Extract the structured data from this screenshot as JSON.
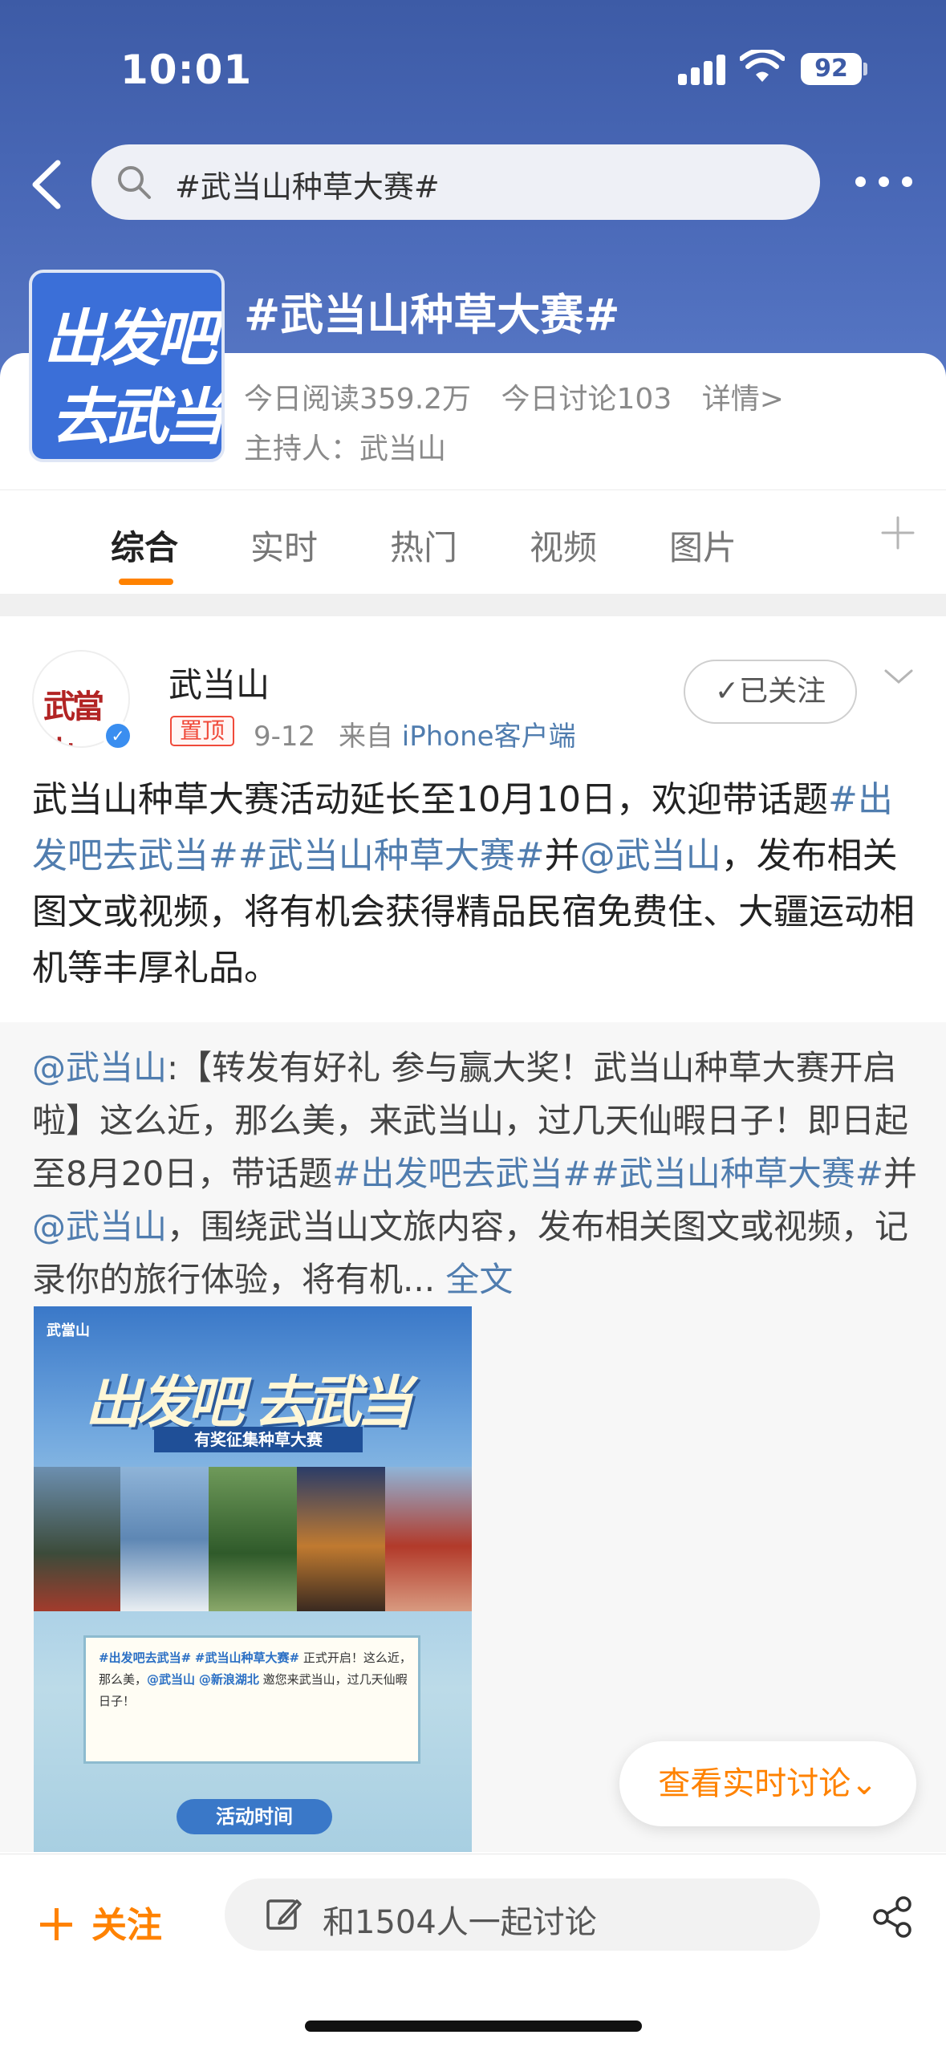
{
  "status_bar": {
    "time": "10:01",
    "battery": "92"
  },
  "search": {
    "query": "#武当山种草大赛#"
  },
  "topic": {
    "logo_line1": "出发吧",
    "logo_line2": "去武当",
    "title": "#武当山种草大赛#",
    "reads_today": "今日阅读359.2万",
    "discussions_today": "今日讨论103",
    "details_link": "详情>",
    "host": "主持人：武当山"
  },
  "tabs": [
    "综合",
    "实时",
    "热门",
    "视频",
    "图片"
  ],
  "post": {
    "avatar_text": "武當山",
    "author": "武当山",
    "pin_label": "置顶",
    "date": "9-12",
    "source_prefix": "来自",
    "source": "iPhone客户端",
    "follow_label": "已关注",
    "text_1": "武当山种草大赛活动延长至10月10日，欢迎带话题",
    "tag_1": "#出发吧去武当#",
    "tag_2": "#武当山种草大赛#",
    "text_2": "并",
    "mention": "@武当山",
    "text_3": "，发布相关图文或视频，将有机会获得精品民宿免费住、大疆运动相机等丰厚礼品。"
  },
  "repost": {
    "mention": "@武当山",
    "text_1": ":【转发有好礼 参与赢大奖！武当山种草大赛开启啦】这么近，那么美，来武当山，过几天仙暇日子！即日起至8月20日，带话题",
    "tag_1": "#出发吧去武当#",
    "tag_2": "#武当山种草大赛#",
    "text_2": "并",
    "mention_2": "@武当山",
    "text_3": "，围绕武当山文旅内容，发布相关图文或视频，记录你的旅行体验，将有机...",
    "full_text_link": "全文"
  },
  "poster": {
    "badge": "武當山",
    "title": "出发吧 去武当",
    "banner": "有奖征集种草大赛",
    "card_tag_1": "#出发吧去武当#",
    "card_tag_2": "#武当山种草大赛#",
    "card_text_1": "正式开启！这么近，那么美，",
    "card_mention_1": "@武当山",
    "card_mention_2": "@新浪湖北",
    "card_text_2": "邀您来武当山，过几天仙暇日子！",
    "time_button": "活动时间"
  },
  "live_discussion_button": "查看实时讨论",
  "bottom_bar": {
    "follow_label": "关注",
    "discuss_placeholder": "和1504人一起讨论"
  },
  "colors": {
    "header_blue": "#4a69b8",
    "accent_orange": "#ff8200",
    "link_blue": "#507daf",
    "pin_red": "#f04a3a"
  },
  "icons": [
    "back-icon",
    "search-icon",
    "more-icon",
    "plus-icon",
    "verified-icon",
    "check-icon",
    "chevron-down-icon",
    "edit-icon",
    "share-icon"
  ]
}
